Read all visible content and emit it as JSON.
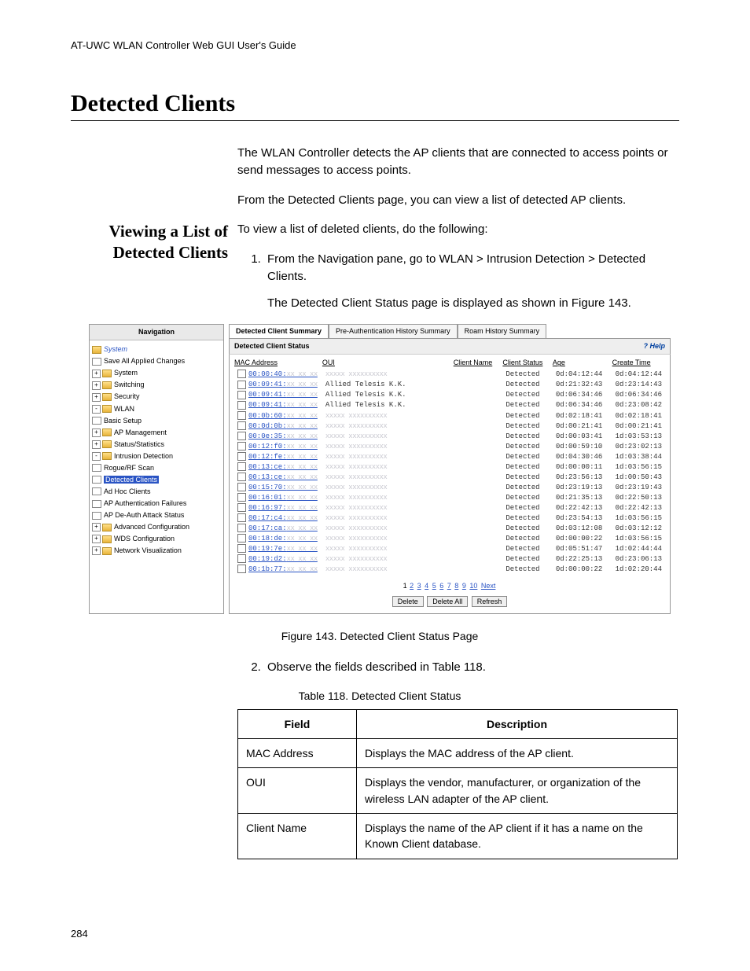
{
  "header": "AT-UWC WLAN Controller Web GUI User's Guide",
  "title": "Detected Clients",
  "intro1": "The WLAN Controller detects the AP clients that are connected to access points or send messages to access points.",
  "intro2": "From the Detected Clients page, you can view a list of detected AP clients.",
  "sideHeading": "Viewing a List of Detected Clients",
  "lead": "To view a list of deleted clients, do the following:",
  "step1a": "From the Navigation pane, go to WLAN > Intrusion Detection > Detected Clients.",
  "step1b": "The Detected Client Status page is displayed as shown in Figure 143.",
  "figcap": "Figure 143. Detected Client Status Page",
  "step2": "Observe the fields described in Table 118.",
  "tablecap": "Table 118. Detected Client Status",
  "tbl": {
    "h1": "Field",
    "h2": "Description",
    "rows": [
      {
        "f": "MAC Address",
        "d": "Displays the MAC address of the AP client."
      },
      {
        "f": "OUI",
        "d": "Displays the vendor, manufacturer, or organization of the wireless LAN adapter of the AP client."
      },
      {
        "f": "Client Name",
        "d": "Displays the name of the AP client if it has a name on the Known Client database."
      }
    ]
  },
  "pagenum": "284",
  "ss": {
    "navTitle": "Navigation",
    "tree": {
      "root": "System",
      "save": "Save All Applied Changes",
      "system": "System",
      "switching": "Switching",
      "security": "Security",
      "wlan": "WLAN",
      "basic": "Basic Setup",
      "apmgmt": "AP Management",
      "status": "Status/Statistics",
      "intrusion": "Intrusion Detection",
      "rogue": "Rogue/RF Scan",
      "detected": "Detected Clients",
      "adhoc": "Ad Hoc Clients",
      "apauth": "AP Authentication Failures",
      "apdeauth": "AP De-Auth Attack Status",
      "advcfg": "Advanced Configuration",
      "wds": "WDS Configuration",
      "netviz": "Network Visualization"
    },
    "tabs": {
      "t1": "Detected Client Summary",
      "t2": "Pre-Authentication History Summary",
      "t3": "Roam History Summary"
    },
    "panelTitle": "Detected Client Status",
    "help": "? Help",
    "cols": {
      "mac": "MAC Address",
      "oui": "OUI",
      "cname": "Client Name",
      "cstat": "Client Status",
      "age": "Age",
      "ctime": "Create Time"
    },
    "rows": [
      {
        "mac": "00:00:40:",
        "oui": "",
        "st": "Detected",
        "age": "0d:04:12:44",
        "ct": "0d:04:12:44"
      },
      {
        "mac": "00:09:41:",
        "oui": "Allied Telesis K.K.",
        "st": "Detected",
        "age": "0d:21:32:43",
        "ct": "0d:23:14:43"
      },
      {
        "mac": "00:09:41:",
        "oui": "Allied Telesis K.K.",
        "st": "Detected",
        "age": "0d:06:34:46",
        "ct": "0d:06:34:46"
      },
      {
        "mac": "00:09:41:",
        "oui": "Allied Telesis K.K.",
        "st": "Detected",
        "age": "0d:06:34:46",
        "ct": "0d:23:08:42"
      },
      {
        "mac": "00:0b:60:",
        "oui": "",
        "st": "Detected",
        "age": "0d:02:18:41",
        "ct": "0d:02:18:41"
      },
      {
        "mac": "00:0d:0b:",
        "oui": "",
        "st": "Detected",
        "age": "0d:00:21:41",
        "ct": "0d:00:21:41"
      },
      {
        "mac": "00:0e:35:",
        "oui": "",
        "st": "Detected",
        "age": "0d:00:03:41",
        "ct": "1d:03:53:13"
      },
      {
        "mac": "00:12:f0:",
        "oui": "",
        "st": "Detected",
        "age": "0d:00:59:10",
        "ct": "0d:23:02:13"
      },
      {
        "mac": "00:12:fe:",
        "oui": "",
        "st": "Detected",
        "age": "0d:04:30:46",
        "ct": "1d:03:38:44"
      },
      {
        "mac": "00:13:ce:",
        "oui": "",
        "st": "Detected",
        "age": "0d:00:00:11",
        "ct": "1d:03:56:15"
      },
      {
        "mac": "00:13:ce:",
        "oui": "",
        "st": "Detected",
        "age": "0d:23:56:13",
        "ct": "1d:00:50:43"
      },
      {
        "mac": "00:15:70:",
        "oui": "",
        "st": "Detected",
        "age": "0d:23:19:13",
        "ct": "0d:23:19:43"
      },
      {
        "mac": "00:16:01:",
        "oui": "",
        "st": "Detected",
        "age": "0d:21:35:13",
        "ct": "0d:22:50:13"
      },
      {
        "mac": "00:16:97:",
        "oui": "",
        "st": "Detected",
        "age": "0d:22:42:13",
        "ct": "0d:22:42:13"
      },
      {
        "mac": "00:17:c4:",
        "oui": "",
        "st": "Detected",
        "age": "0d:23:54:13",
        "ct": "1d:03:56:15"
      },
      {
        "mac": "00:17:ca:",
        "oui": "",
        "st": "Detected",
        "age": "0d:03:12:08",
        "ct": "0d:03:12:12"
      },
      {
        "mac": "00:18:de:",
        "oui": "",
        "st": "Detected",
        "age": "0d:00:00:22",
        "ct": "1d:03:56:15"
      },
      {
        "mac": "00:19:7e:",
        "oui": "",
        "st": "Detected",
        "age": "0d:05:51:47",
        "ct": "1d:02:44:44"
      },
      {
        "mac": "00:19:d2:",
        "oui": "",
        "st": "Detected",
        "age": "0d:22:25:13",
        "ct": "0d:23:06:13"
      },
      {
        "mac": "00:1b:77:",
        "oui": "",
        "st": "Detected",
        "age": "0d:00:00:22",
        "ct": "1d:02:20:44"
      }
    ],
    "pager": {
      "pages": [
        "1",
        "2",
        "3",
        "4",
        "5",
        "6",
        "7",
        "8",
        "9",
        "10"
      ],
      "next": "Next"
    },
    "btns": {
      "del": "Delete",
      "delall": "Delete All",
      "refresh": "Refresh"
    }
  }
}
